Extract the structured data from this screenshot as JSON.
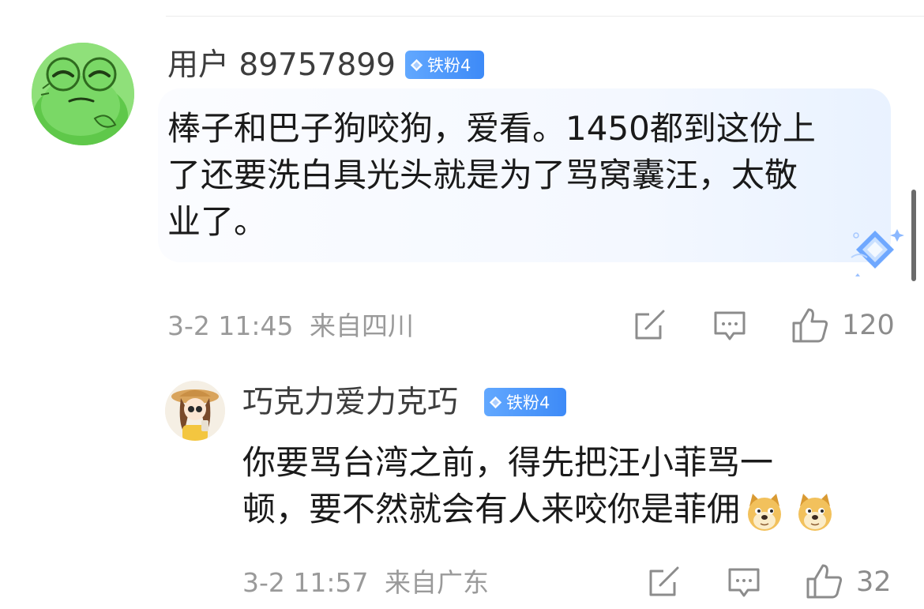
{
  "comments": [
    {
      "username": "用户 89757899",
      "badge": "铁粉4",
      "content_lines": [
        "棒子和巴子狗咬狗，爱看。1450都到这份上",
        "了还要洗白具光头就是为了骂窝囊汪，太敬",
        "业了。"
      ],
      "time": "3-2 11:45",
      "location": "来自四川",
      "likes": "120",
      "avatar": "frog-avatar",
      "has_decorated_bubble": true
    },
    {
      "username": "巧克力爱力克巧",
      "badge": "铁粉4",
      "content_lines": [
        "你要骂台湾之前，得先把汪小菲骂一",
        "顿，要不然就会有人来咬你是菲佣"
      ],
      "emojis": [
        "doge-emoji",
        "doge-emoji"
      ],
      "time": "3-2 11:57",
      "location": "来自广东",
      "likes": "32",
      "avatar": "girl-avatar"
    }
  ],
  "colors": {
    "badge_blue": "#4a94fb",
    "meta_gray": "#9a9a9a",
    "avatar_green": "#8fe07a"
  },
  "icons": [
    "share-icon",
    "comment-icon",
    "like-icon",
    "diamond-icon"
  ]
}
